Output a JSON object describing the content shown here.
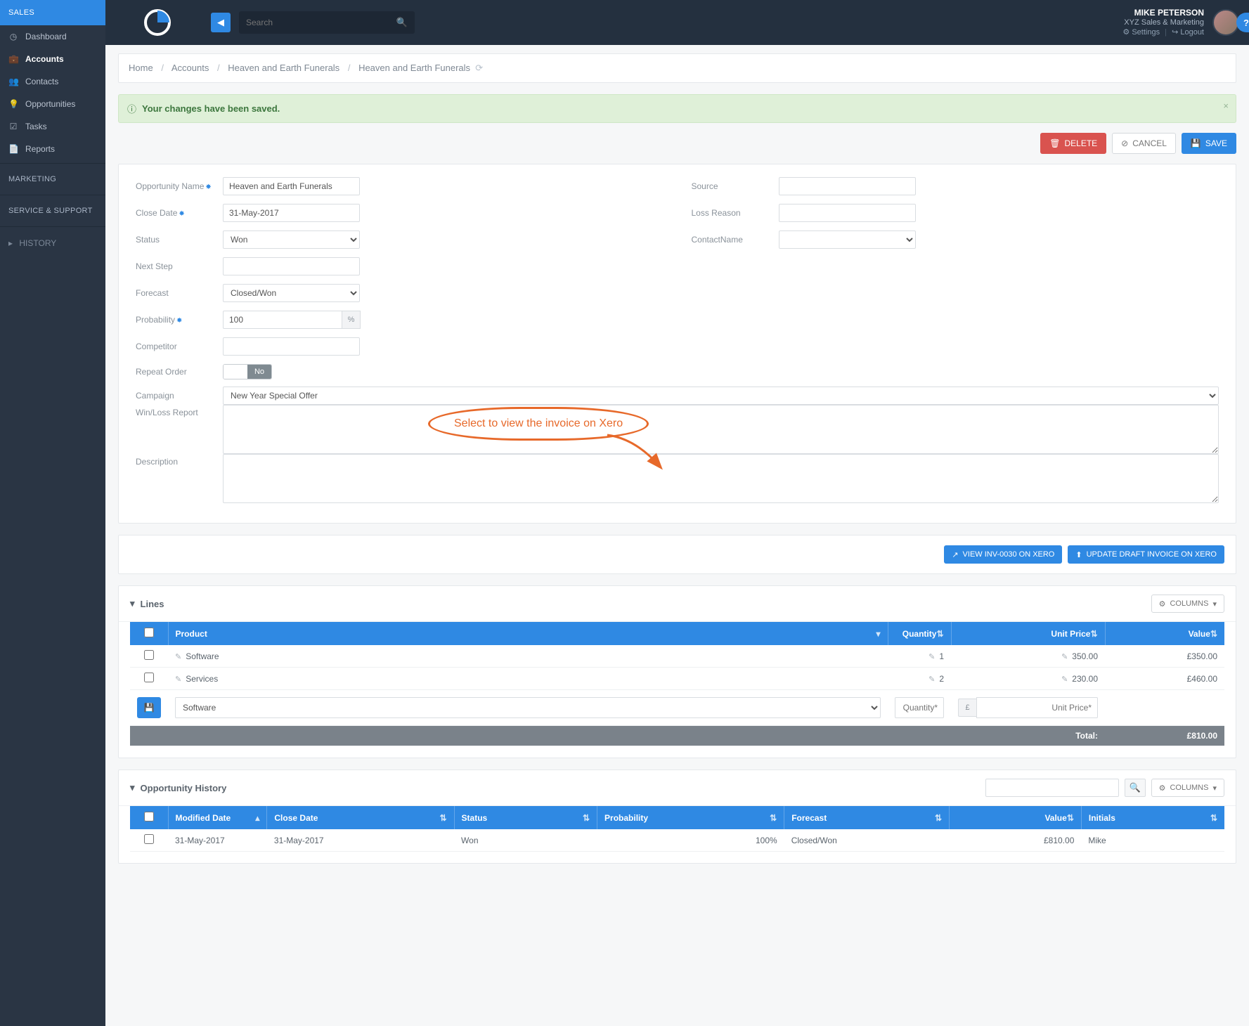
{
  "header": {
    "search_placeholder": "Search",
    "user_name": "MIKE PETERSON",
    "user_org": "XYZ Sales & Marketing",
    "settings_label": "Settings",
    "logout_label": "Logout"
  },
  "sidebar": {
    "sections": {
      "sales": "SALES",
      "marketing": "MARKETING",
      "service": "SERVICE & SUPPORT",
      "history": "HISTORY"
    },
    "items": [
      {
        "label": "Dashboard",
        "icon": "dashboard-icon"
      },
      {
        "label": "Accounts",
        "icon": "briefcase-icon",
        "active": true
      },
      {
        "label": "Contacts",
        "icon": "users-icon"
      },
      {
        "label": "Opportunities",
        "icon": "lightbulb-icon"
      },
      {
        "label": "Tasks",
        "icon": "check-icon"
      },
      {
        "label": "Reports",
        "icon": "file-icon"
      }
    ]
  },
  "breadcrumb": {
    "home": "Home",
    "accounts": "Accounts",
    "account_name": "Heaven and Earth Funerals",
    "record_name": "Heaven and Earth Funerals"
  },
  "alert": {
    "message": "Your changes have been saved."
  },
  "actions": {
    "delete": "DELETE",
    "cancel": "CANCEL",
    "save": "SAVE"
  },
  "form": {
    "labels": {
      "opportunity_name": "Opportunity Name",
      "close_date": "Close Date",
      "status": "Status",
      "next_step": "Next Step",
      "forecast": "Forecast",
      "probability": "Probability",
      "competitor": "Competitor",
      "repeat_order": "Repeat Order",
      "campaign": "Campaign",
      "winloss": "Win/Loss Report",
      "description": "Description",
      "source": "Source",
      "loss_reason": "Loss Reason",
      "contact_name": "ContactName"
    },
    "values": {
      "opportunity_name": "Heaven and Earth Funerals",
      "close_date": "31-May-2017",
      "status": "Won",
      "next_step": "",
      "forecast": "Closed/Won",
      "probability": "100",
      "probability_suffix": "%",
      "competitor": "",
      "repeat_order_no": "No",
      "campaign": "New Year Special Offer",
      "winloss": "",
      "description": "",
      "source": "",
      "loss_reason": "",
      "contact_name": ""
    }
  },
  "callout": {
    "text": "Select to view the invoice on Xero"
  },
  "xero": {
    "view_label": "VIEW INV-0030 ON XERO",
    "update_label": "UPDATE DRAFT INVOICE ON XERO"
  },
  "lines": {
    "title": "Lines",
    "columns_label": "COLUMNS",
    "headers": {
      "product": "Product",
      "quantity": "Quantity",
      "unit_price": "Unit Price",
      "value": "Value"
    },
    "rows": [
      {
        "product": "Software",
        "quantity": "1",
        "unit_price": "350.00",
        "value": "£350.00"
      },
      {
        "product": "Services",
        "quantity": "2",
        "unit_price": "230.00",
        "value": "£460.00"
      }
    ],
    "add_row": {
      "product_option": "Software",
      "quantity_placeholder": "Quantity*",
      "currency_prefix": "£",
      "unitprice_placeholder": "Unit Price*"
    },
    "total_label": "Total:",
    "total_value": "£810.00"
  },
  "history": {
    "title": "Opportunity History",
    "columns_label": "COLUMNS",
    "headers": {
      "modified": "Modified Date",
      "close": "Close Date",
      "status": "Status",
      "probability": "Probability",
      "forecast": "Forecast",
      "value": "Value",
      "initials": "Initials"
    },
    "rows": [
      {
        "modified": "31-May-2017",
        "close": "31-May-2017",
        "status": "Won",
        "probability": "100%",
        "forecast": "Closed/Won",
        "value": "£810.00",
        "initials": "Mike"
      }
    ]
  },
  "colors": {
    "primary": "#2f89e3",
    "danger": "#d9534f",
    "callout": "#e7692a"
  }
}
